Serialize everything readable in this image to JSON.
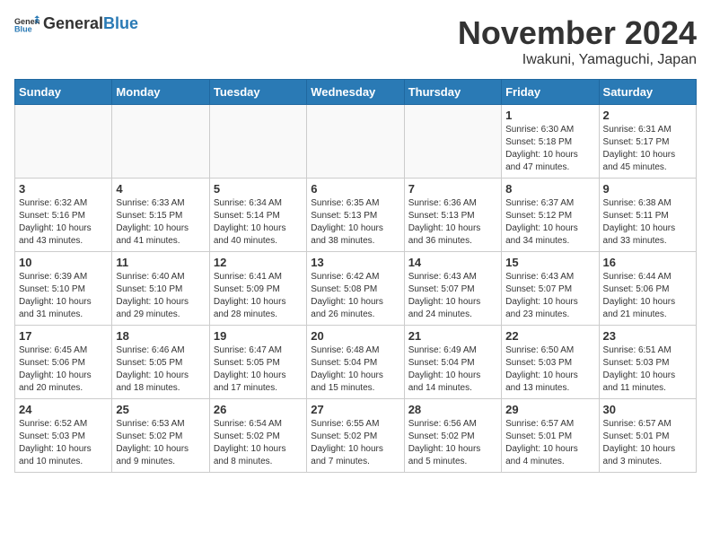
{
  "header": {
    "logo_general": "General",
    "logo_blue": "Blue",
    "title": "November 2024",
    "subtitle": "Iwakuni, Yamaguchi, Japan"
  },
  "weekdays": [
    "Sunday",
    "Monday",
    "Tuesday",
    "Wednesday",
    "Thursday",
    "Friday",
    "Saturday"
  ],
  "weeks": [
    [
      {
        "day": "",
        "info": ""
      },
      {
        "day": "",
        "info": ""
      },
      {
        "day": "",
        "info": ""
      },
      {
        "day": "",
        "info": ""
      },
      {
        "day": "",
        "info": ""
      },
      {
        "day": "1",
        "info": "Sunrise: 6:30 AM\nSunset: 5:18 PM\nDaylight: 10 hours and 47 minutes."
      },
      {
        "day": "2",
        "info": "Sunrise: 6:31 AM\nSunset: 5:17 PM\nDaylight: 10 hours and 45 minutes."
      }
    ],
    [
      {
        "day": "3",
        "info": "Sunrise: 6:32 AM\nSunset: 5:16 PM\nDaylight: 10 hours and 43 minutes."
      },
      {
        "day": "4",
        "info": "Sunrise: 6:33 AM\nSunset: 5:15 PM\nDaylight: 10 hours and 41 minutes."
      },
      {
        "day": "5",
        "info": "Sunrise: 6:34 AM\nSunset: 5:14 PM\nDaylight: 10 hours and 40 minutes."
      },
      {
        "day": "6",
        "info": "Sunrise: 6:35 AM\nSunset: 5:13 PM\nDaylight: 10 hours and 38 minutes."
      },
      {
        "day": "7",
        "info": "Sunrise: 6:36 AM\nSunset: 5:13 PM\nDaylight: 10 hours and 36 minutes."
      },
      {
        "day": "8",
        "info": "Sunrise: 6:37 AM\nSunset: 5:12 PM\nDaylight: 10 hours and 34 minutes."
      },
      {
        "day": "9",
        "info": "Sunrise: 6:38 AM\nSunset: 5:11 PM\nDaylight: 10 hours and 33 minutes."
      }
    ],
    [
      {
        "day": "10",
        "info": "Sunrise: 6:39 AM\nSunset: 5:10 PM\nDaylight: 10 hours and 31 minutes."
      },
      {
        "day": "11",
        "info": "Sunrise: 6:40 AM\nSunset: 5:10 PM\nDaylight: 10 hours and 29 minutes."
      },
      {
        "day": "12",
        "info": "Sunrise: 6:41 AM\nSunset: 5:09 PM\nDaylight: 10 hours and 28 minutes."
      },
      {
        "day": "13",
        "info": "Sunrise: 6:42 AM\nSunset: 5:08 PM\nDaylight: 10 hours and 26 minutes."
      },
      {
        "day": "14",
        "info": "Sunrise: 6:43 AM\nSunset: 5:07 PM\nDaylight: 10 hours and 24 minutes."
      },
      {
        "day": "15",
        "info": "Sunrise: 6:43 AM\nSunset: 5:07 PM\nDaylight: 10 hours and 23 minutes."
      },
      {
        "day": "16",
        "info": "Sunrise: 6:44 AM\nSunset: 5:06 PM\nDaylight: 10 hours and 21 minutes."
      }
    ],
    [
      {
        "day": "17",
        "info": "Sunrise: 6:45 AM\nSunset: 5:06 PM\nDaylight: 10 hours and 20 minutes."
      },
      {
        "day": "18",
        "info": "Sunrise: 6:46 AM\nSunset: 5:05 PM\nDaylight: 10 hours and 18 minutes."
      },
      {
        "day": "19",
        "info": "Sunrise: 6:47 AM\nSunset: 5:05 PM\nDaylight: 10 hours and 17 minutes."
      },
      {
        "day": "20",
        "info": "Sunrise: 6:48 AM\nSunset: 5:04 PM\nDaylight: 10 hours and 15 minutes."
      },
      {
        "day": "21",
        "info": "Sunrise: 6:49 AM\nSunset: 5:04 PM\nDaylight: 10 hours and 14 minutes."
      },
      {
        "day": "22",
        "info": "Sunrise: 6:50 AM\nSunset: 5:03 PM\nDaylight: 10 hours and 13 minutes."
      },
      {
        "day": "23",
        "info": "Sunrise: 6:51 AM\nSunset: 5:03 PM\nDaylight: 10 hours and 11 minutes."
      }
    ],
    [
      {
        "day": "24",
        "info": "Sunrise: 6:52 AM\nSunset: 5:03 PM\nDaylight: 10 hours and 10 minutes."
      },
      {
        "day": "25",
        "info": "Sunrise: 6:53 AM\nSunset: 5:02 PM\nDaylight: 10 hours and 9 minutes."
      },
      {
        "day": "26",
        "info": "Sunrise: 6:54 AM\nSunset: 5:02 PM\nDaylight: 10 hours and 8 minutes."
      },
      {
        "day": "27",
        "info": "Sunrise: 6:55 AM\nSunset: 5:02 PM\nDaylight: 10 hours and 7 minutes."
      },
      {
        "day": "28",
        "info": "Sunrise: 6:56 AM\nSunset: 5:02 PM\nDaylight: 10 hours and 5 minutes."
      },
      {
        "day": "29",
        "info": "Sunrise: 6:57 AM\nSunset: 5:01 PM\nDaylight: 10 hours and 4 minutes."
      },
      {
        "day": "30",
        "info": "Sunrise: 6:57 AM\nSunset: 5:01 PM\nDaylight: 10 hours and 3 minutes."
      }
    ]
  ]
}
